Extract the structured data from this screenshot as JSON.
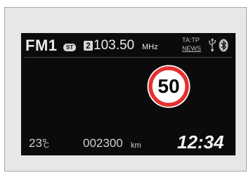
{
  "radio": {
    "band": "FM1",
    "stereo_badge": "ST",
    "preset": "2",
    "frequency": "103.50",
    "frequency_unit": "MHz",
    "ta_tp": "TA:TP",
    "news": "NEWS"
  },
  "status_icons": [
    "usb-icon",
    "bluetooth-icon"
  ],
  "speed_limit": {
    "value": "50",
    "ring_color": "#e53030"
  },
  "footer": {
    "temperature": "23°",
    "temperature_unit": "C",
    "odometer": "002300",
    "odometer_unit": "km",
    "clock": "12:34"
  },
  "colors": {
    "screen_background": "#0b0b0b",
    "frame_background": "#e7e7e7",
    "text": "#eaeaea"
  }
}
